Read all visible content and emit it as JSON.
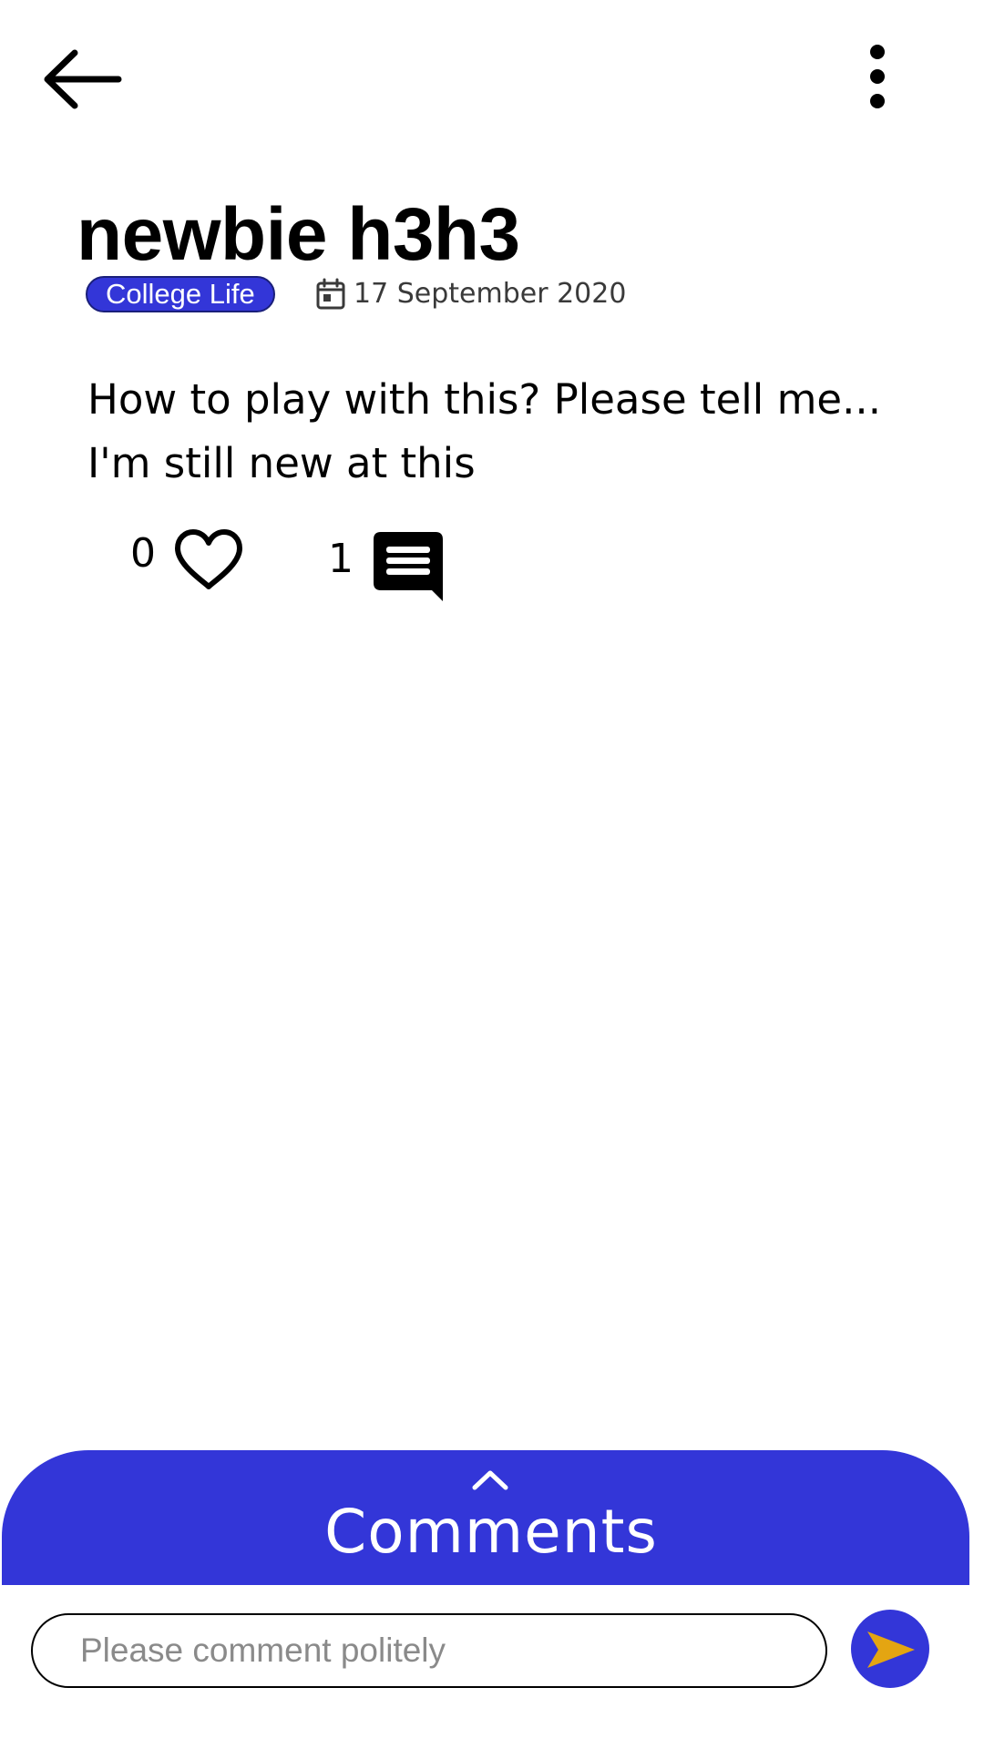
{
  "colors": {
    "accent": "#3336d8",
    "send_arrow": "#e4a512",
    "text": "#000000",
    "muted": "#3a3a3a"
  },
  "icons": {
    "back": "arrow-left",
    "more": "dots-vertical",
    "calendar": "calendar",
    "like": "heart-outline",
    "comment": "comment-bubble",
    "expand": "chevron-up",
    "send": "send-arrow"
  },
  "post": {
    "title": "newbie h3h3",
    "tag": "College Life",
    "date": "17 September 2020",
    "body_lines": [
      "How to play with this? Please tell me...",
      "I'm still new at this"
    ],
    "like_count": "0",
    "comment_count": "1"
  },
  "comments_panel": {
    "label": "Comments"
  },
  "comment_input": {
    "placeholder": "Please comment politely",
    "value": ""
  }
}
